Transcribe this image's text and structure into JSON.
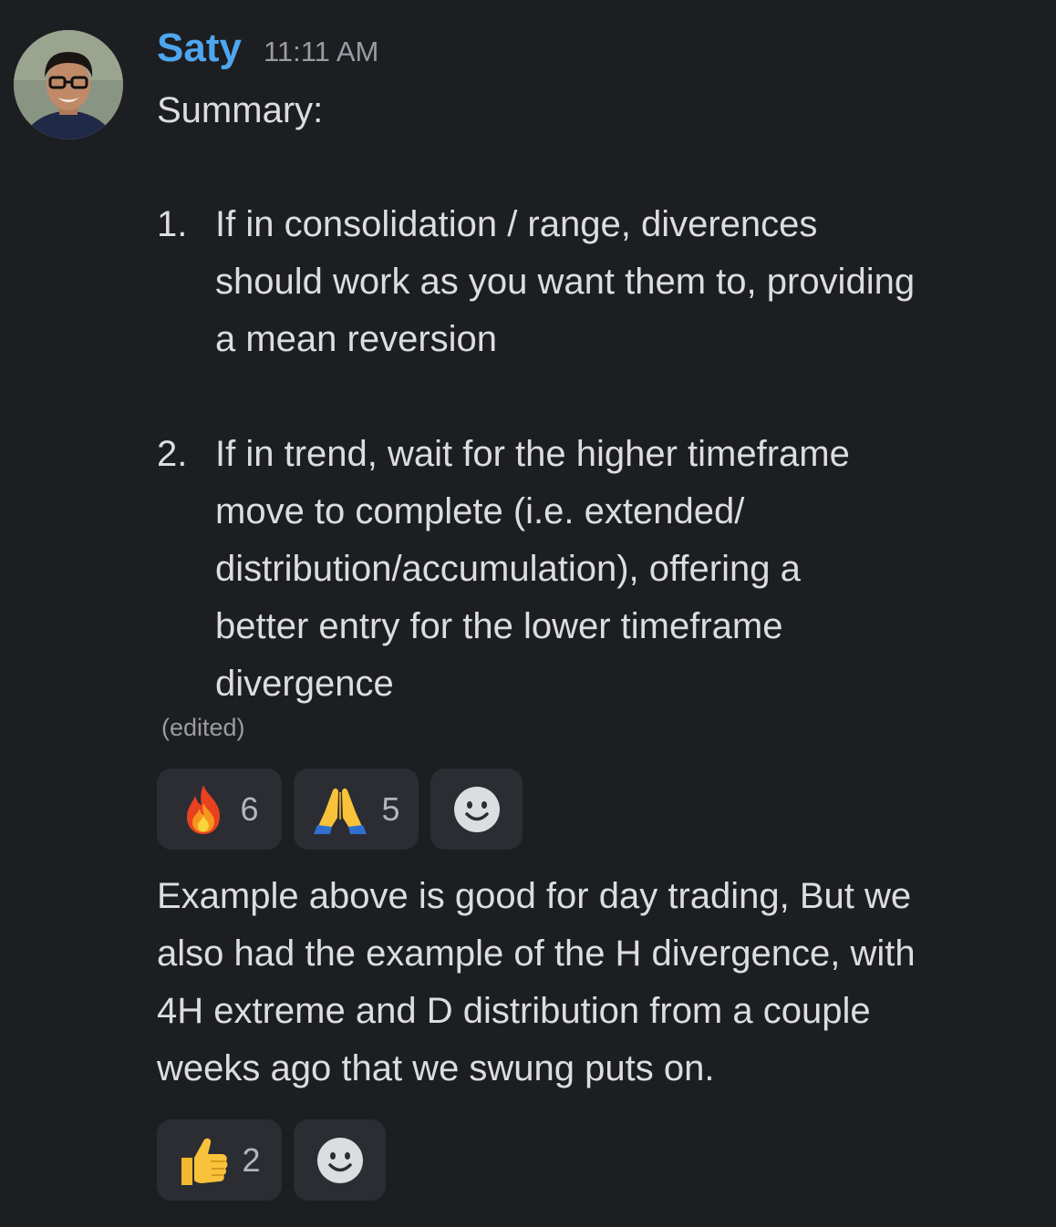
{
  "author": {
    "name": "Saty",
    "timestamp": "11:11 AM",
    "avatar_icon": "user-avatar"
  },
  "message1": {
    "intro": "Summary:",
    "items": [
      {
        "number": "1.",
        "lines": [
          "If in consolidation / range, diverences",
          "should work as you want them to, providing",
          "a mean reversion"
        ]
      },
      {
        "number": "2.",
        "lines": [
          "If in trend, wait for the higher timeframe",
          "move to complete (i.e. extended/",
          "distribution/accumulation), offering a",
          "better entry for the lower timeframe",
          "divergence"
        ]
      }
    ],
    "edited_label": "(edited)",
    "reactions": [
      {
        "emoji": "fire-icon",
        "count": "6"
      },
      {
        "emoji": "folded-hands-icon",
        "count": "5"
      }
    ]
  },
  "message2": {
    "lines": [
      "Example above is good for day trading, But we",
      "also had the example of the H divergence, with",
      "4H extreme and D distribution from a couple",
      "weeks ago that we swung puts on."
    ],
    "reactions": [
      {
        "emoji": "thumbs-up-icon",
        "count": "2"
      }
    ]
  },
  "colors": {
    "background": "#1d1e22",
    "username": "#4ea6ef",
    "text": "#dcdde1",
    "muted": "#9b9ca3",
    "reaction_bg": "#2c2d33"
  }
}
